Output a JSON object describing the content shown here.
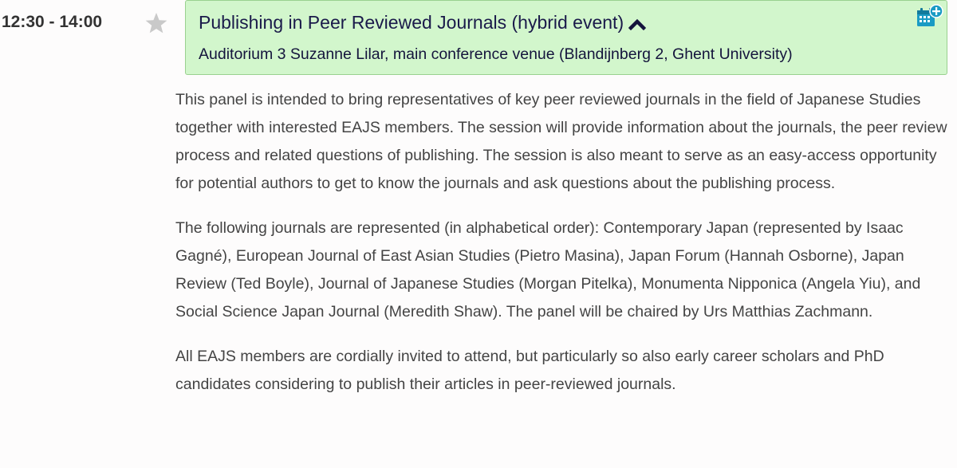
{
  "session": {
    "time": "12:30 - 14:00",
    "favorite_icon": "star-icon",
    "title": "Publishing in Peer Reviewed Journals (hybrid event)",
    "collapse_icon": "chevron-up-icon",
    "location": "Auditorium 3 Suzanne Lilar, main conference venue (Blandijnberg 2, Ghent University)",
    "calendar_icon": "calendar-add-icon",
    "header_bg": "#d2f6cc",
    "header_border": "#99d18f",
    "calendar_color": "#1a9bc4",
    "paragraphs": [
      "This panel is intended to bring representatives of key peer reviewed journals in the field of Japanese Studies together with interested EAJS members. The session will provide information about the journals, the peer review process and related questions of publishing. The session is also meant to serve as an easy-access opportunity for potential authors to get to know the journals and ask questions about the publishing process.",
      "The following journals are represented (in alphabetical order): Contemporary Japan (represented by Isaac Gagné), European Journal of East Asian Studies (Pietro Masina), Japan Forum (Hannah Osborne), Japan Review (Ted Boyle), Journal of Japanese Studies (Morgan Pitelka), Monumenta Nipponica (Angela Yiu), and Social Science Japan Journal (Meredith Shaw). The panel will be chaired by Urs Matthias Zachmann.",
      "All EAJS members are cordially invited to attend, but particularly so also early career scholars and PhD candidates considering to publish their articles in peer-reviewed journals."
    ]
  }
}
